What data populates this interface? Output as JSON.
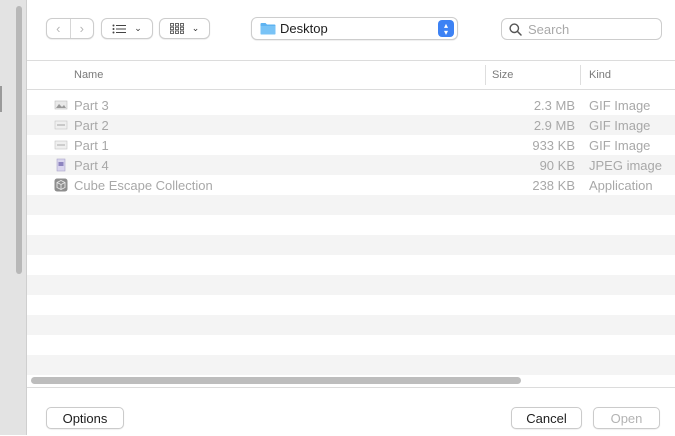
{
  "toolbar": {
    "location": "Desktop",
    "search_placeholder": "Search"
  },
  "columns": {
    "name": "Name",
    "size": "Size",
    "kind": "Kind"
  },
  "files": [
    {
      "name": "Part 3",
      "size": "2.3 MB",
      "kind": "GIF Image",
      "icon": "gif-file-icon"
    },
    {
      "name": "Part 2",
      "size": "2.9 MB",
      "kind": "GIF Image",
      "icon": "gif-file-icon"
    },
    {
      "name": "Part 1",
      "size": "933 KB",
      "kind": "GIF Image",
      "icon": "gif-file-icon"
    },
    {
      "name": "Part 4",
      "size": "90 KB",
      "kind": "JPEG image",
      "icon": "jpeg-file-icon"
    },
    {
      "name": "Cube Escape Collection",
      "size": "238 KB",
      "kind": "Application",
      "icon": "application-icon"
    }
  ],
  "buttons": {
    "options": "Options",
    "cancel": "Cancel",
    "open": "Open"
  },
  "colors": {
    "accent": "#3d82f4",
    "row_alt": "#f4f4f4",
    "disabled_text": "#a8a8a8"
  }
}
